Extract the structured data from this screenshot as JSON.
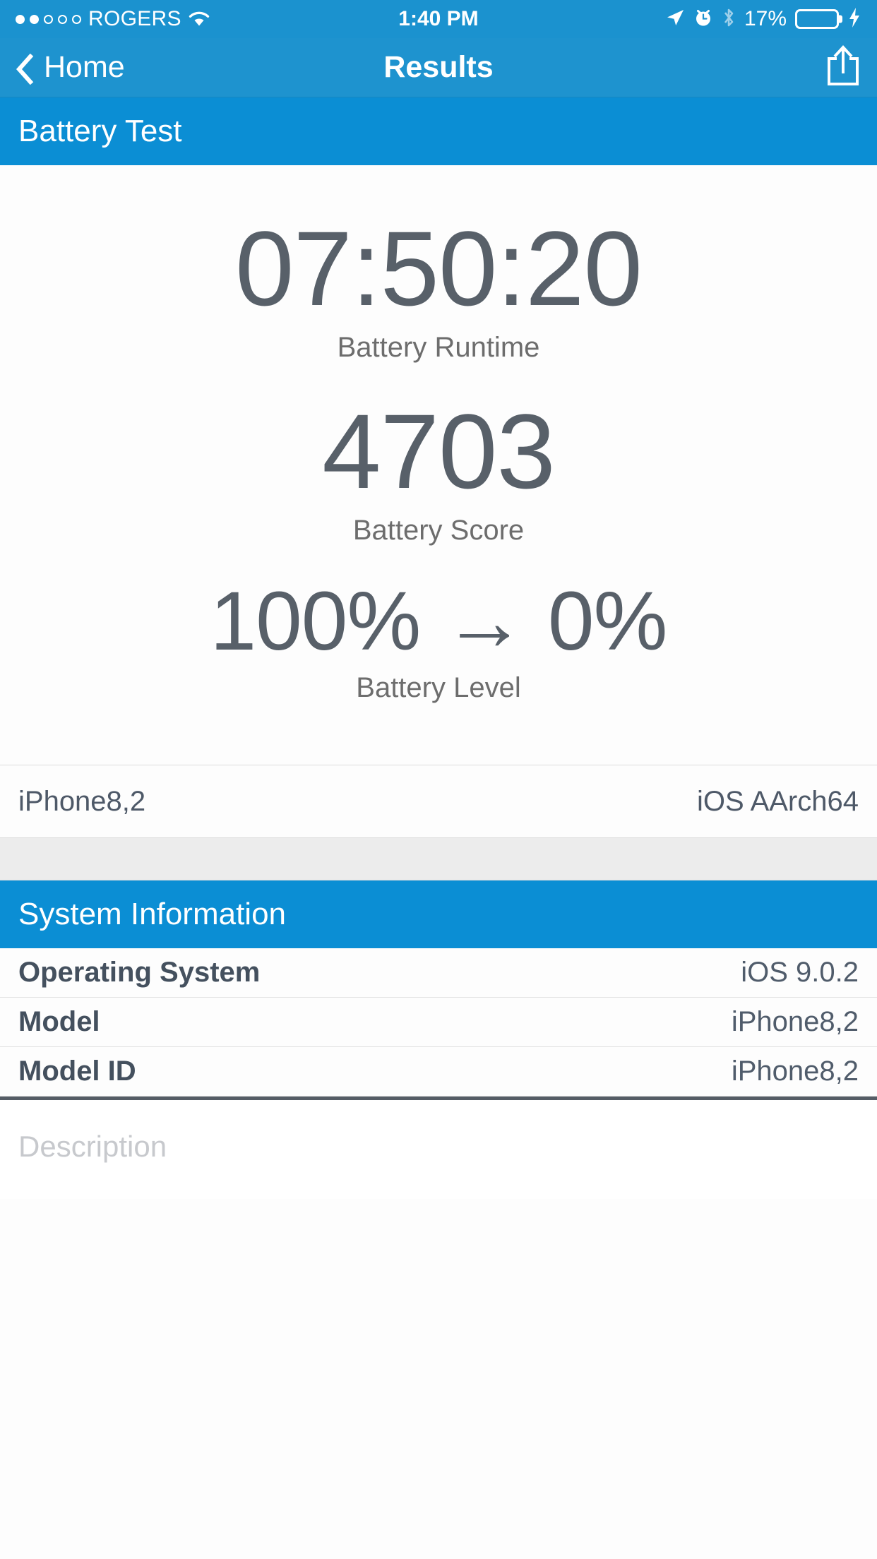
{
  "status_bar": {
    "carrier": "ROGERS",
    "signal_dots_filled": 2,
    "signal_dots_total": 5,
    "wifi_icon": "wifi-icon",
    "time": "1:40 PM",
    "location_icon": "location-arrow-icon",
    "alarm_icon": "alarm-clock-icon",
    "bluetooth_icon": "bluetooth-icon",
    "battery_percent_label": "17%",
    "battery_fill_percent": 17,
    "battery_fill_color": "#f53b32",
    "charging_icon": "lightning-bolt-icon"
  },
  "nav_bar": {
    "back_label": "Home",
    "back_icon": "chevron-left-icon",
    "title": "Results",
    "share_icon": "share-upload-icon",
    "background_color": "#1e93cf"
  },
  "battery_test": {
    "section_title": "Battery Test",
    "section_color": "#0b8ed4",
    "metrics": [
      {
        "value": "07:50:20",
        "label": "Battery Runtime"
      },
      {
        "value": "4703",
        "label": "Battery Score"
      },
      {
        "value": "100% → 0%",
        "label": "Battery Level"
      }
    ],
    "device_row": {
      "model": "iPhone8,2",
      "platform": "iOS AArch64"
    }
  },
  "system_information": {
    "section_title": "System Information",
    "rows": [
      {
        "key": "Operating System",
        "value": "iOS 9.0.2"
      },
      {
        "key": "Model",
        "value": "iPhone8,2"
      },
      {
        "key": "Model ID",
        "value": "iPhone8,2"
      }
    ]
  },
  "description": {
    "placeholder": "Description",
    "value": ""
  }
}
